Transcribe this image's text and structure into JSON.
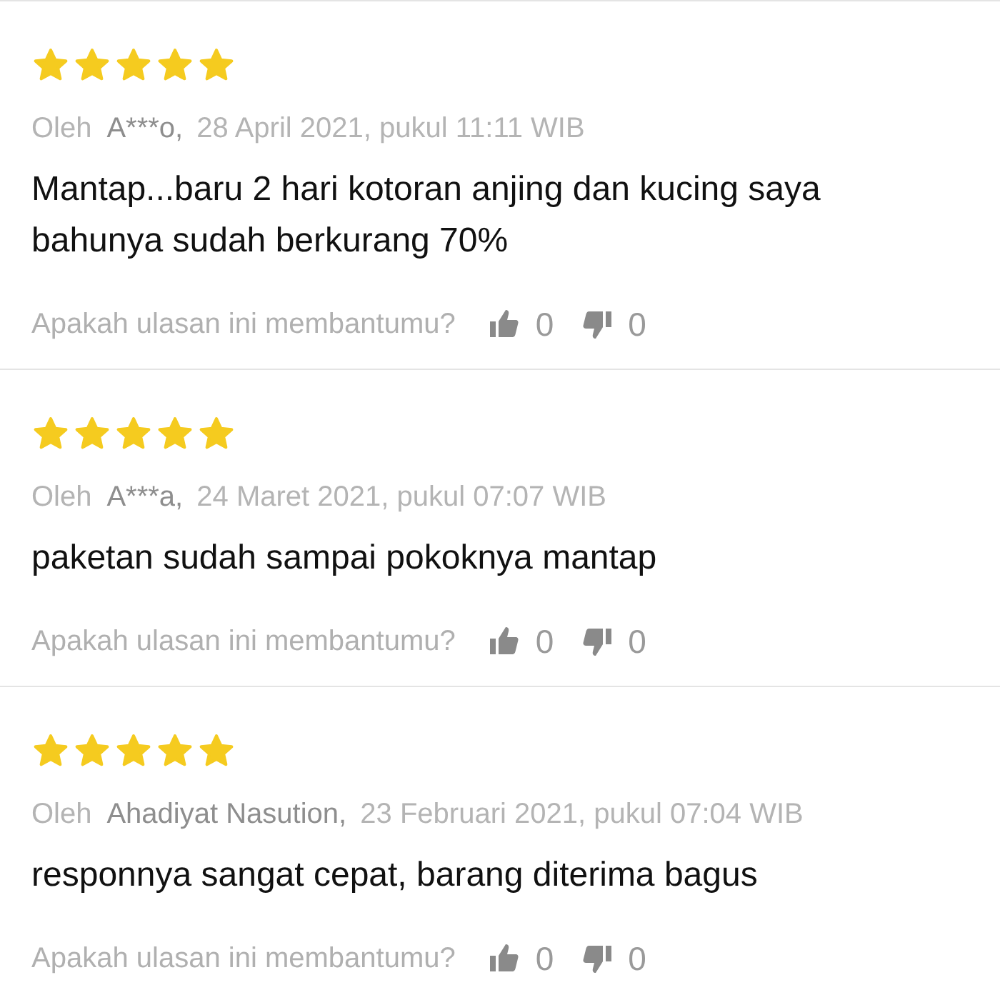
{
  "reviews": [
    {
      "stars": 5,
      "by": "Oleh",
      "author": "A***o,",
      "date": "28 April 2021, pukul 11:11 WIB",
      "text": "Mantap...baru 2 hari kotoran anjing dan kucing saya bahunya sudah berkurang 70%",
      "question": "Apakah ulasan ini membantumu?",
      "likes": "0",
      "dislikes": "0"
    },
    {
      "stars": 5,
      "by": "Oleh",
      "author": "A***a,",
      "date": "24 Maret 2021, pukul 07:07 WIB",
      "text": "paketan sudah sampai pokoknya mantap",
      "question": "Apakah ulasan ini membantumu?",
      "likes": "0",
      "dislikes": "0"
    },
    {
      "stars": 5,
      "by": "Oleh",
      "author": "Ahadiyat Nasution,",
      "date": "23 Februari 2021, pukul 07:04 WIB",
      "text": "responnya sangat cepat, barang diterima bagus",
      "question": "Apakah ulasan ini membantumu?",
      "likes": "0",
      "dislikes": "0"
    }
  ]
}
